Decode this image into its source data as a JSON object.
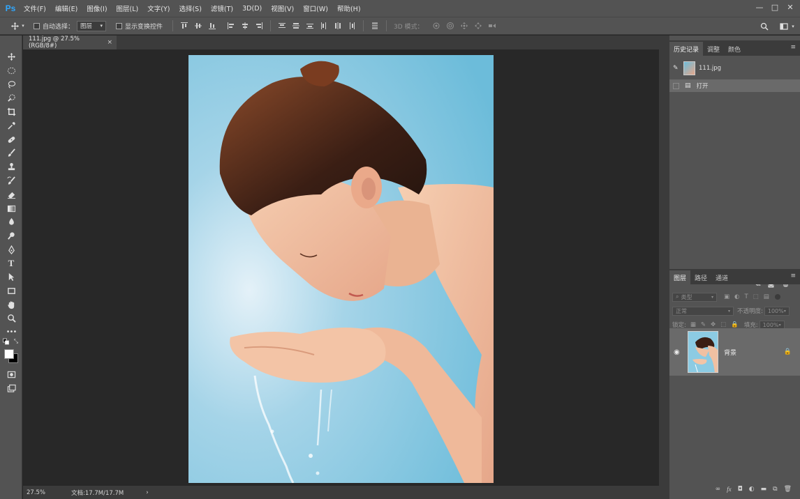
{
  "app": {
    "logo": "Ps",
    "menus": [
      "文件(F)",
      "编辑(E)",
      "图像(I)",
      "图层(L)",
      "文字(Y)",
      "选择(S)",
      "滤镜(T)",
      "3D(D)",
      "视图(V)",
      "窗口(W)",
      "帮助(H)"
    ],
    "window_controls": [
      "—",
      "□",
      "✕"
    ]
  },
  "options_bar": {
    "auto_select_label": "自动选择：",
    "auto_select_value": "图层",
    "show_transform_label": "显示变换控件",
    "mode_3d_label": "3D 模式："
  },
  "document": {
    "tab_title": "111.jpg @ 27.5%(RGB/8#)",
    "tab_close": "×"
  },
  "status_bar": {
    "zoom": "27.5%",
    "doc_size": "文档:17.7M/17.7M",
    "arrow": "›"
  },
  "history_panel": {
    "tabs": [
      "历史记录",
      "调整",
      "颜色"
    ],
    "snapshot_name": "111.jpg",
    "steps": [
      "打开"
    ]
  },
  "layers_panel": {
    "tabs": [
      "图层",
      "路径",
      "通道"
    ],
    "filter_placeholder": "类型",
    "blend_mode": "正常",
    "opacity_label": "不透明度:",
    "opacity_value": "100%",
    "lock_label": "锁定:",
    "fill_label": "填充:",
    "fill_value": "100%",
    "layers": [
      {
        "name": "背景",
        "visible": true,
        "locked": true
      }
    ]
  },
  "colors": {
    "chrome": "#535353",
    "dark": "#3b3b3b",
    "canvas_bg": "#282828",
    "accent": "#31a8ff"
  }
}
